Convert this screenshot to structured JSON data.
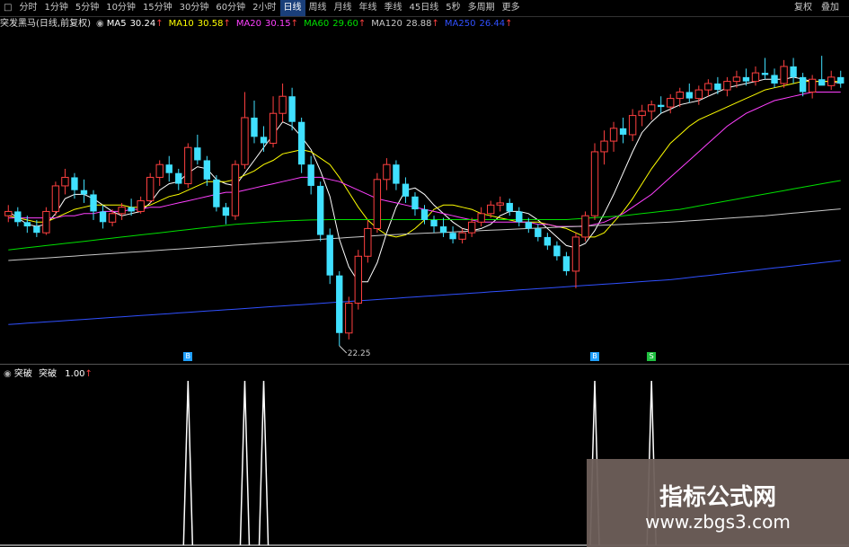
{
  "toolbar": {
    "tabs": [
      "分时",
      "1分钟",
      "5分钟",
      "10分钟",
      "15分钟",
      "30分钟",
      "60分钟",
      "2小时",
      "日线",
      "周线",
      "月线",
      "年线",
      "季线",
      "45日线",
      "5秒",
      "多周期",
      "更多"
    ],
    "active_index": 8,
    "right": [
      "复权",
      "叠加"
    ]
  },
  "mabar": {
    "title": "突发黑马(日线,前复权)",
    "items": [
      {
        "label": "MA5",
        "value": "30.24",
        "color": "#ffffff"
      },
      {
        "label": "MA10",
        "value": "30.58",
        "color": "#ffff00"
      },
      {
        "label": "MA20",
        "value": "30.15",
        "color": "#ff40ff"
      },
      {
        "label": "MA60",
        "value": "29.60",
        "color": "#00e000"
      },
      {
        "label": "MA120",
        "value": "28.88",
        "color": "#c8c8c8"
      },
      {
        "label": "MA250",
        "value": "26.44",
        "color": "#3050ff"
      }
    ]
  },
  "price_annotation": "22.25",
  "signal_labels": [
    {
      "text": "B",
      "color": "#20a0ff"
    },
    {
      "text": "S",
      "color": "#20c040"
    }
  ],
  "indicator": {
    "name": "突破",
    "label": "突破",
    "value": "1.00"
  },
  "watermark": {
    "title": "指标公式网",
    "url": "www.zbgs3.com"
  },
  "colors": {
    "up": "#ff4040",
    "down": "#40e0ff",
    "ma5": "#ffffff",
    "ma10": "#ffff00",
    "ma20": "#ff40ff",
    "ma60": "#00e000",
    "ma120": "#c8c8c8",
    "ma250": "#3050ff"
  },
  "chart_data": {
    "type": "candlestick",
    "candles": [
      [
        28.4,
        28.9,
        28.1,
        28.6
      ],
      [
        28.6,
        28.8,
        27.9,
        28.1
      ],
      [
        28.1,
        28.4,
        27.6,
        27.9
      ],
      [
        27.9,
        28.2,
        27.4,
        27.6
      ],
      [
        27.6,
        28.8,
        27.5,
        28.6
      ],
      [
        28.6,
        30.0,
        28.4,
        29.8
      ],
      [
        29.8,
        30.6,
        29.4,
        30.2
      ],
      [
        30.2,
        30.4,
        29.2,
        29.6
      ],
      [
        29.6,
        30.1,
        29.0,
        29.4
      ],
      [
        29.4,
        29.6,
        28.2,
        28.6
      ],
      [
        28.6,
        28.9,
        27.8,
        28.1
      ],
      [
        28.1,
        28.7,
        27.9,
        28.5
      ],
      [
        28.5,
        29.0,
        28.2,
        28.8
      ],
      [
        28.8,
        29.2,
        28.4,
        28.6
      ],
      [
        28.6,
        29.3,
        28.5,
        29.1
      ],
      [
        29.1,
        30.4,
        29.0,
        30.2
      ],
      [
        30.2,
        31.0,
        29.8,
        30.8
      ],
      [
        30.8,
        31.2,
        30.0,
        30.4
      ],
      [
        30.4,
        30.6,
        29.6,
        29.9
      ],
      [
        29.9,
        31.8,
        29.7,
        31.6
      ],
      [
        31.6,
        32.2,
        30.8,
        31.0
      ],
      [
        31.0,
        31.2,
        29.8,
        30.1
      ],
      [
        30.1,
        30.3,
        28.6,
        28.8
      ],
      [
        28.8,
        29.0,
        28.0,
        28.4
      ],
      [
        28.4,
        31.0,
        28.2,
        30.8
      ],
      [
        30.8,
        34.2,
        30.6,
        33.0
      ],
      [
        33.0,
        33.8,
        31.8,
        32.1
      ],
      [
        32.1,
        32.6,
        31.4,
        31.8
      ],
      [
        31.8,
        34.0,
        31.6,
        33.2
      ],
      [
        33.2,
        34.6,
        32.8,
        34.0
      ],
      [
        34.0,
        34.4,
        32.4,
        32.8
      ],
      [
        32.8,
        33.0,
        30.4,
        30.8
      ],
      [
        30.8,
        31.2,
        29.4,
        29.8
      ],
      [
        29.8,
        30.0,
        27.2,
        27.5
      ],
      [
        27.5,
        27.8,
        25.2,
        25.6
      ],
      [
        25.6,
        25.8,
        22.3,
        22.9
      ],
      [
        22.9,
        24.6,
        22.6,
        24.3
      ],
      [
        24.3,
        26.8,
        24.0,
        26.5
      ],
      [
        26.5,
        28.2,
        26.2,
        27.8
      ],
      [
        27.8,
        30.4,
        27.6,
        30.1
      ],
      [
        30.1,
        31.1,
        29.6,
        30.8
      ],
      [
        30.8,
        31.0,
        29.6,
        29.9
      ],
      [
        29.9,
        30.2,
        29.0,
        29.3
      ],
      [
        29.3,
        29.5,
        28.4,
        28.7
      ],
      [
        28.7,
        28.9,
        28.0,
        28.2
      ],
      [
        28.2,
        28.4,
        27.6,
        27.9
      ],
      [
        27.9,
        28.3,
        27.4,
        27.6
      ],
      [
        27.6,
        27.9,
        27.1,
        27.3
      ],
      [
        27.3,
        27.8,
        27.1,
        27.6
      ],
      [
        27.6,
        28.3,
        27.4,
        28.1
      ],
      [
        28.1,
        28.8,
        27.9,
        28.5
      ],
      [
        28.5,
        29.1,
        28.3,
        28.9
      ],
      [
        28.9,
        29.3,
        28.6,
        29.0
      ],
      [
        29.0,
        29.2,
        28.4,
        28.6
      ],
      [
        28.6,
        28.8,
        27.9,
        28.1
      ],
      [
        28.1,
        28.3,
        27.6,
        27.8
      ],
      [
        27.8,
        28.0,
        27.2,
        27.4
      ],
      [
        27.4,
        27.6,
        26.8,
        27.0
      ],
      [
        27.0,
        27.2,
        26.3,
        26.5
      ],
      [
        26.5,
        26.7,
        25.6,
        25.8
      ],
      [
        25.8,
        27.6,
        25.0,
        27.4
      ],
      [
        27.4,
        28.6,
        27.2,
        28.4
      ],
      [
        28.4,
        31.8,
        28.2,
        31.4
      ],
      [
        31.4,
        32.4,
        30.8,
        31.9
      ],
      [
        31.9,
        32.8,
        31.4,
        32.5
      ],
      [
        32.5,
        33.0,
        31.8,
        32.2
      ],
      [
        32.2,
        33.4,
        31.9,
        33.1
      ],
      [
        33.1,
        33.6,
        32.6,
        33.3
      ],
      [
        33.3,
        33.8,
        32.9,
        33.6
      ],
      [
        33.6,
        34.0,
        33.2,
        33.5
      ],
      [
        33.5,
        34.1,
        33.2,
        33.9
      ],
      [
        33.9,
        34.4,
        33.5,
        34.2
      ],
      [
        34.2,
        34.6,
        33.7,
        33.9
      ],
      [
        33.9,
        34.5,
        33.6,
        34.3
      ],
      [
        34.3,
        34.8,
        34.0,
        34.6
      ],
      [
        34.6,
        34.9,
        34.1,
        34.3
      ],
      [
        34.3,
        34.9,
        34.0,
        34.7
      ],
      [
        34.7,
        35.2,
        34.4,
        34.9
      ],
      [
        34.9,
        35.3,
        34.5,
        34.7
      ],
      [
        34.7,
        35.4,
        34.5,
        35.1
      ],
      [
        35.1,
        35.8,
        34.8,
        35.0
      ],
      [
        35.0,
        35.3,
        34.4,
        34.6
      ],
      [
        34.6,
        35.7,
        34.4,
        35.4
      ],
      [
        35.4,
        35.8,
        34.6,
        34.9
      ],
      [
        34.9,
        35.1,
        34.0,
        34.2
      ],
      [
        34.2,
        35.0,
        33.9,
        34.8
      ],
      [
        34.8,
        35.9,
        34.6,
        34.5
      ],
      [
        34.5,
        35.2,
        34.3,
        34.9
      ],
      [
        34.9,
        35.2,
        34.4,
        34.6
      ]
    ],
    "ma_lines": [
      {
        "name": "MA5",
        "color": "#ffffff",
        "values": [
          28.6,
          28.3,
          28.0,
          27.9,
          28.0,
          28.5,
          29.2,
          29.4,
          29.4,
          29.2,
          28.9,
          28.6,
          28.4,
          28.5,
          28.6,
          29.0,
          29.6,
          29.9,
          30.0,
          30.4,
          30.7,
          30.6,
          30.1,
          29.9,
          29.8,
          30.4,
          31.0,
          31.6,
          32.2,
          32.8,
          32.6,
          32.1,
          31.5,
          30.5,
          29.3,
          27.3,
          26.0,
          25.3,
          25.3,
          26.2,
          27.6,
          28.8,
          29.6,
          29.7,
          29.4,
          28.9,
          28.5,
          28.1,
          27.8,
          27.7,
          27.8,
          28.0,
          28.4,
          28.6,
          28.6,
          28.5,
          28.2,
          27.8,
          27.4,
          27.0,
          26.9,
          27.1,
          27.7,
          28.5,
          29.4,
          30.4,
          31.4,
          32.3,
          32.8,
          33.2,
          33.4,
          33.6,
          33.7,
          33.8,
          34.0,
          34.2,
          34.4,
          34.5,
          34.6,
          34.7,
          34.8,
          34.8,
          34.8,
          34.9,
          34.8,
          34.7,
          34.7,
          34.7,
          34.6
        ]
      },
      {
        "name": "MA10",
        "color": "#ffff00",
        "values": [
          28.4,
          28.3,
          28.2,
          28.1,
          28.1,
          28.3,
          28.5,
          28.7,
          28.8,
          28.9,
          28.9,
          28.9,
          28.9,
          28.8,
          28.8,
          28.9,
          29.1,
          29.3,
          29.4,
          29.6,
          29.8,
          30.0,
          30.0,
          30.0,
          30.1,
          30.3,
          30.5,
          30.8,
          31.0,
          31.3,
          31.4,
          31.5,
          31.4,
          31.1,
          30.8,
          30.2,
          29.5,
          28.8,
          28.2,
          27.8,
          27.5,
          27.4,
          27.5,
          27.8,
          28.2,
          28.7,
          28.9,
          28.9,
          28.8,
          28.7,
          28.5,
          28.4,
          28.3,
          28.2,
          28.1,
          28.1,
          28.1,
          28.0,
          27.9,
          27.8,
          27.6,
          27.4,
          27.4,
          27.6,
          28.1,
          28.6,
          29.2,
          29.9,
          30.6,
          31.2,
          31.8,
          32.2,
          32.6,
          32.9,
          33.1,
          33.3,
          33.5,
          33.7,
          33.9,
          34.1,
          34.3,
          34.4,
          34.5,
          34.6,
          34.7,
          34.7,
          34.7,
          34.7,
          34.7
        ]
      },
      {
        "name": "MA20",
        "color": "#ff40ff",
        "values": [
          28.3,
          28.3,
          28.3,
          28.3,
          28.3,
          28.3,
          28.4,
          28.4,
          28.5,
          28.5,
          28.6,
          28.6,
          28.6,
          28.7,
          28.7,
          28.8,
          28.8,
          28.9,
          29.0,
          29.1,
          29.2,
          29.3,
          29.4,
          29.5,
          29.5,
          29.6,
          29.7,
          29.8,
          29.9,
          30.0,
          30.1,
          30.2,
          30.2,
          30.2,
          30.1,
          30.0,
          29.8,
          29.6,
          29.4,
          29.2,
          29.1,
          29.0,
          28.9,
          28.8,
          28.7,
          28.6,
          28.5,
          28.4,
          28.3,
          28.2,
          28.1,
          28.1,
          28.1,
          28.1,
          28.1,
          28.1,
          28.0,
          28.0,
          27.9,
          27.9,
          27.9,
          27.9,
          28.0,
          28.1,
          28.3,
          28.5,
          28.8,
          29.1,
          29.4,
          29.8,
          30.2,
          30.6,
          31.0,
          31.4,
          31.8,
          32.2,
          32.6,
          32.9,
          33.2,
          33.4,
          33.6,
          33.8,
          33.9,
          34.0,
          34.1,
          34.2,
          34.2,
          34.2,
          34.2
        ]
      },
      {
        "name": "MA60",
        "color": "#00e000",
        "values": [
          26.8,
          26.85,
          26.9,
          26.95,
          27.0,
          27.05,
          27.1,
          27.15,
          27.2,
          27.25,
          27.3,
          27.35,
          27.4,
          27.45,
          27.5,
          27.55,
          27.6,
          27.65,
          27.7,
          27.75,
          27.8,
          27.85,
          27.9,
          27.95,
          28.0,
          28.03,
          28.06,
          28.09,
          28.12,
          28.15,
          28.17,
          28.19,
          28.2,
          28.21,
          28.22,
          28.22,
          28.22,
          28.22,
          28.22,
          28.22,
          28.22,
          28.22,
          28.22,
          28.22,
          28.22,
          28.22,
          28.22,
          28.22,
          28.22,
          28.22,
          28.22,
          28.22,
          28.22,
          28.22,
          28.22,
          28.22,
          28.22,
          28.22,
          28.22,
          28.22,
          28.25,
          28.28,
          28.31,
          28.34,
          28.37,
          28.4,
          28.45,
          28.5,
          28.55,
          28.6,
          28.65,
          28.7,
          28.78,
          28.86,
          28.94,
          29.02,
          29.1,
          29.18,
          29.26,
          29.34,
          29.42,
          29.5,
          29.58,
          29.66,
          29.74,
          29.82,
          29.9,
          29.98,
          30.05
        ]
      },
      {
        "name": "MA120",
        "color": "#c8c8c8",
        "values": [
          26.3,
          26.33,
          26.36,
          26.39,
          26.42,
          26.45,
          26.48,
          26.51,
          26.54,
          26.57,
          26.6,
          26.63,
          26.66,
          26.69,
          26.72,
          26.75,
          26.78,
          26.81,
          26.84,
          26.87,
          26.9,
          26.93,
          26.96,
          26.99,
          27.02,
          27.05,
          27.08,
          27.11,
          27.14,
          27.17,
          27.2,
          27.23,
          27.26,
          27.29,
          27.32,
          27.35,
          27.38,
          27.41,
          27.44,
          27.47,
          27.5,
          27.52,
          27.54,
          27.56,
          27.58,
          27.6,
          27.62,
          27.64,
          27.66,
          27.68,
          27.7,
          27.72,
          27.74,
          27.76,
          27.78,
          27.8,
          27.82,
          27.84,
          27.86,
          27.88,
          27.9,
          27.92,
          27.94,
          27.96,
          27.98,
          28.0,
          28.02,
          28.04,
          28.06,
          28.08,
          28.1,
          28.13,
          28.16,
          28.19,
          28.22,
          28.25,
          28.28,
          28.31,
          28.34,
          28.37,
          28.4,
          28.44,
          28.48,
          28.52,
          28.56,
          28.6,
          28.64,
          28.68,
          28.72
        ]
      },
      {
        "name": "MA250",
        "color": "#3050ff",
        "values": [
          23.3,
          23.33,
          23.36,
          23.39,
          23.42,
          23.45,
          23.48,
          23.51,
          23.54,
          23.57,
          23.6,
          23.63,
          23.66,
          23.69,
          23.72,
          23.75,
          23.78,
          23.81,
          23.84,
          23.87,
          23.9,
          23.93,
          23.96,
          23.99,
          24.02,
          24.05,
          24.08,
          24.11,
          24.14,
          24.17,
          24.2,
          24.23,
          24.26,
          24.29,
          24.32,
          24.35,
          24.38,
          24.41,
          24.44,
          24.47,
          24.5,
          24.53,
          24.56,
          24.59,
          24.62,
          24.65,
          24.68,
          24.71,
          24.74,
          24.77,
          24.8,
          24.83,
          24.86,
          24.89,
          24.92,
          24.95,
          24.98,
          25.01,
          25.04,
          25.07,
          25.1,
          25.13,
          25.16,
          25.19,
          25.22,
          25.25,
          25.28,
          25.31,
          25.34,
          25.37,
          25.4,
          25.45,
          25.5,
          25.55,
          25.6,
          25.65,
          25.7,
          25.75,
          25.8,
          25.85,
          25.9,
          25.95,
          26.0,
          26.05,
          26.1,
          26.15,
          26.2,
          26.25,
          26.3
        ]
      }
    ],
    "signal_days": [
      19,
      25,
      27,
      62,
      68
    ],
    "ylim": [
      21.5,
      37.0
    ]
  }
}
